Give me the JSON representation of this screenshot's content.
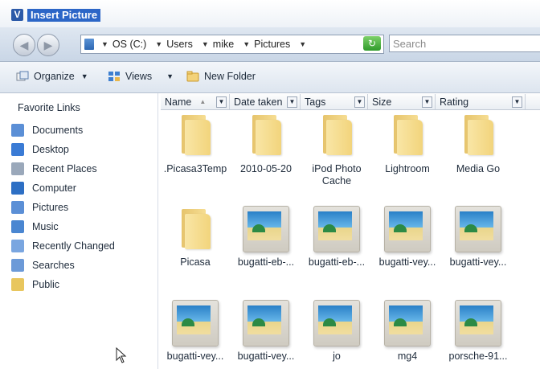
{
  "window": {
    "title": "Insert Picture"
  },
  "nav": {
    "breadcrumbs": [
      {
        "label": "OS (C:)"
      },
      {
        "label": "Users"
      },
      {
        "label": "mike"
      },
      {
        "label": "Pictures"
      }
    ],
    "search_placeholder": "Search"
  },
  "toolbar": {
    "organize_label": "Organize",
    "views_label": "Views",
    "new_folder_label": "New Folder"
  },
  "sidebar": {
    "title": "Favorite Links",
    "items": [
      {
        "label": "Documents",
        "icon": "documents-icon",
        "color": "#5b8fd6"
      },
      {
        "label": "Desktop",
        "icon": "desktop-icon",
        "color": "#3a7bd5"
      },
      {
        "label": "Recent Places",
        "icon": "recent-places-icon",
        "color": "#9aa8ba"
      },
      {
        "label": "Computer",
        "icon": "computer-icon",
        "color": "#2d6fc4"
      },
      {
        "label": "Pictures",
        "icon": "pictures-icon",
        "color": "#5b8fd6"
      },
      {
        "label": "Music",
        "icon": "music-icon",
        "color": "#4a86d1"
      },
      {
        "label": "Recently Changed",
        "icon": "recently-changed-icon",
        "color": "#7aa6e0"
      },
      {
        "label": "Searches",
        "icon": "searches-icon",
        "color": "#6c9ad8"
      },
      {
        "label": "Public",
        "icon": "public-folder-icon",
        "color": "#e8c65e"
      }
    ]
  },
  "columns": [
    {
      "label": "Name"
    },
    {
      "label": "Date taken"
    },
    {
      "label": "Tags"
    },
    {
      "label": "Size"
    },
    {
      "label": "Rating"
    }
  ],
  "files": [
    {
      "name": ".Picasa3Temp",
      "type": "folder"
    },
    {
      "name": "2010-05-20",
      "type": "folder"
    },
    {
      "name": "iPod Photo Cache",
      "type": "folder"
    },
    {
      "name": "Lightroom",
      "type": "folder"
    },
    {
      "name": "Media Go",
      "type": "folder"
    },
    {
      "name": "Picasa",
      "type": "folder"
    },
    {
      "name": "bugatti-eb-...",
      "type": "image"
    },
    {
      "name": "bugatti-eb-...",
      "type": "image"
    },
    {
      "name": "bugatti-vey...",
      "type": "image"
    },
    {
      "name": "bugatti-vey...",
      "type": "image"
    },
    {
      "name": "bugatti-vey...",
      "type": "image"
    },
    {
      "name": "bugatti-vey...",
      "type": "image"
    },
    {
      "name": "jo",
      "type": "image"
    },
    {
      "name": "mg4",
      "type": "image"
    },
    {
      "name": "porsche-91...",
      "type": "image"
    }
  ]
}
